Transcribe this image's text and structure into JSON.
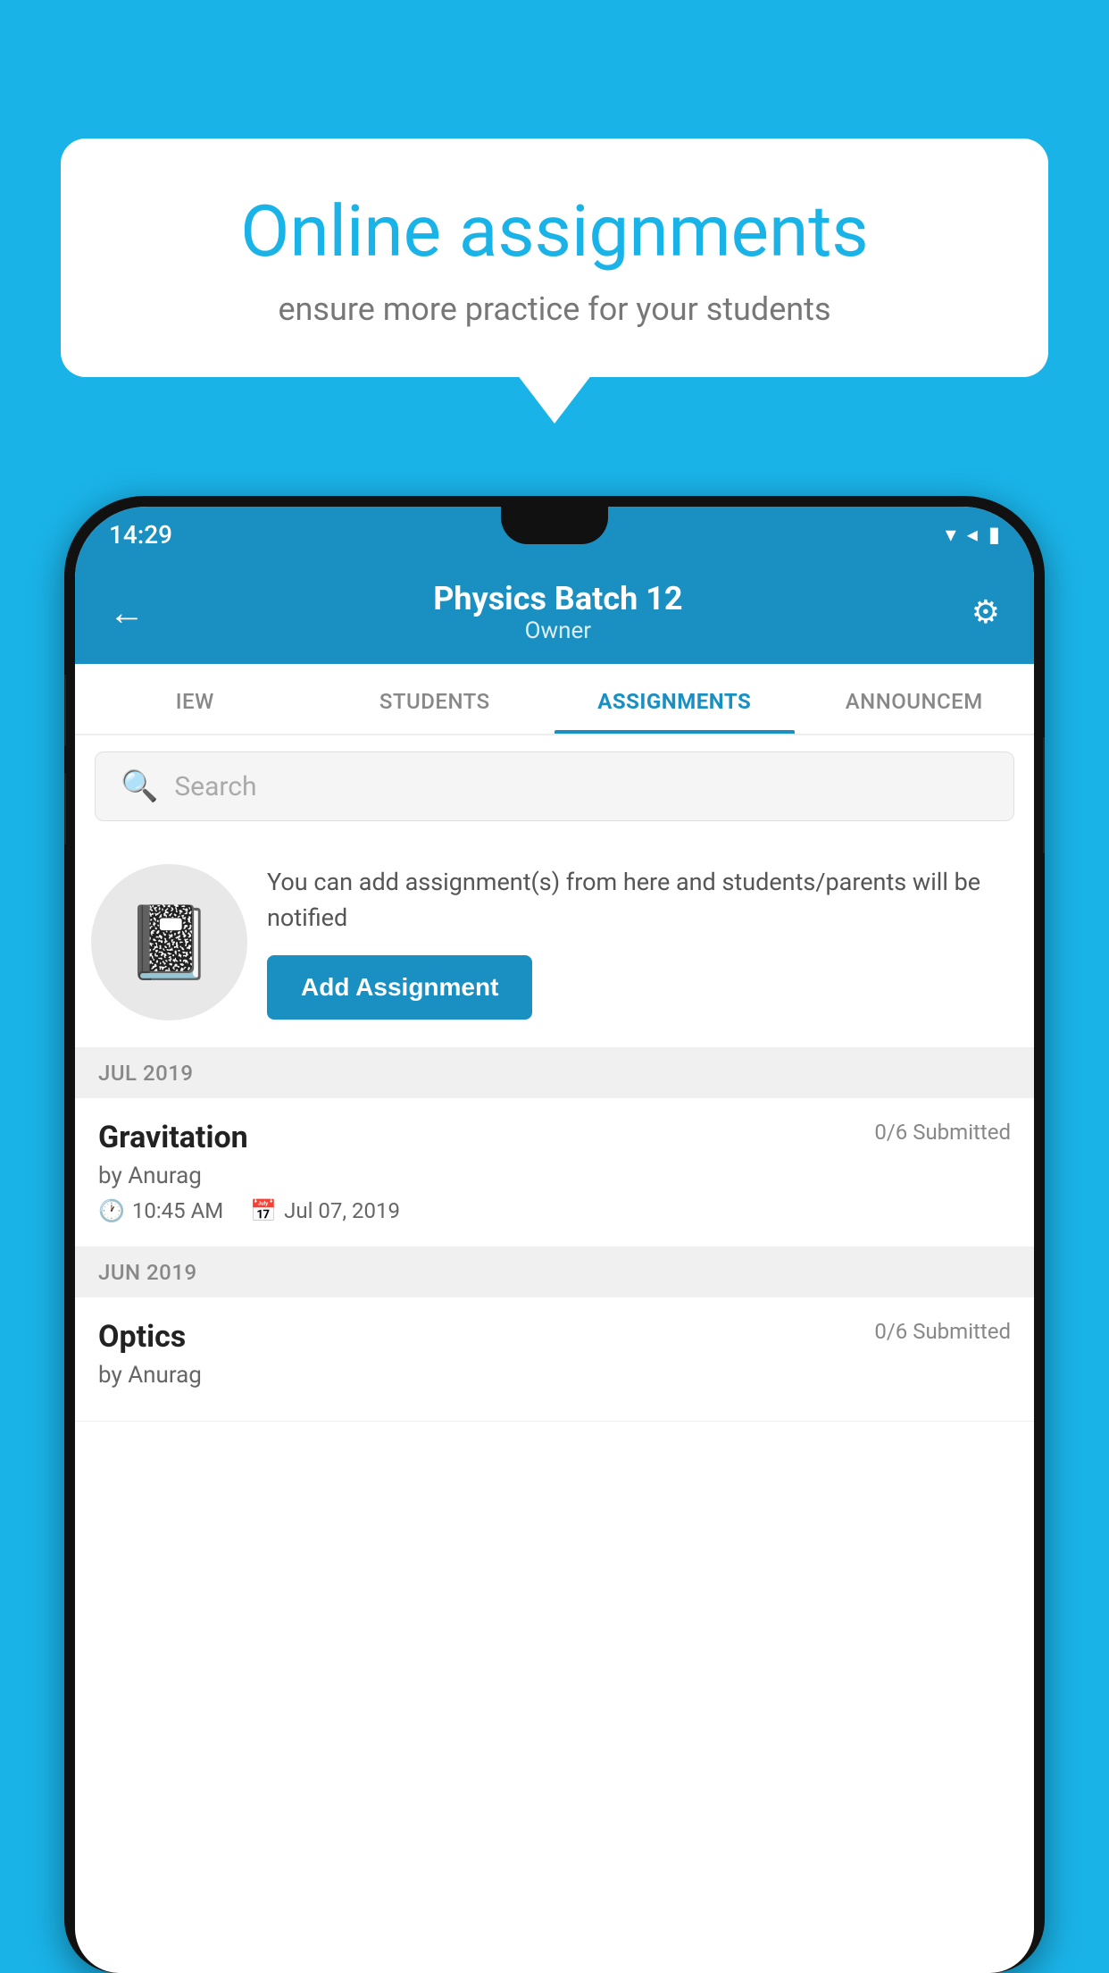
{
  "background_color": "#1ab3e8",
  "speech_bubble": {
    "title": "Online assignments",
    "subtitle": "ensure more practice for your students"
  },
  "phone": {
    "status_bar": {
      "time": "14:29",
      "icons": "▾◂▮"
    },
    "header": {
      "title": "Physics Batch 12",
      "subtitle": "Owner",
      "back_label": "←",
      "settings_label": "⚙"
    },
    "tabs": [
      {
        "label": "IEW",
        "active": false
      },
      {
        "label": "STUDENTS",
        "active": false
      },
      {
        "label": "ASSIGNMENTS",
        "active": true
      },
      {
        "label": "ANNOUNCEM",
        "active": false
      }
    ],
    "search": {
      "placeholder": "Search"
    },
    "promo": {
      "text": "You can add assignment(s) from here and students/parents will be notified",
      "button_label": "Add Assignment"
    },
    "sections": [
      {
        "month": "JUL 2019",
        "assignments": [
          {
            "title": "Gravitation",
            "submitted": "0/6 Submitted",
            "by": "by Anurag",
            "time": "10:45 AM",
            "date": "Jul 07, 2019"
          }
        ]
      },
      {
        "month": "JUN 2019",
        "assignments": [
          {
            "title": "Optics",
            "submitted": "0/6 Submitted",
            "by": "by Anurag",
            "time": "",
            "date": ""
          }
        ]
      }
    ]
  }
}
